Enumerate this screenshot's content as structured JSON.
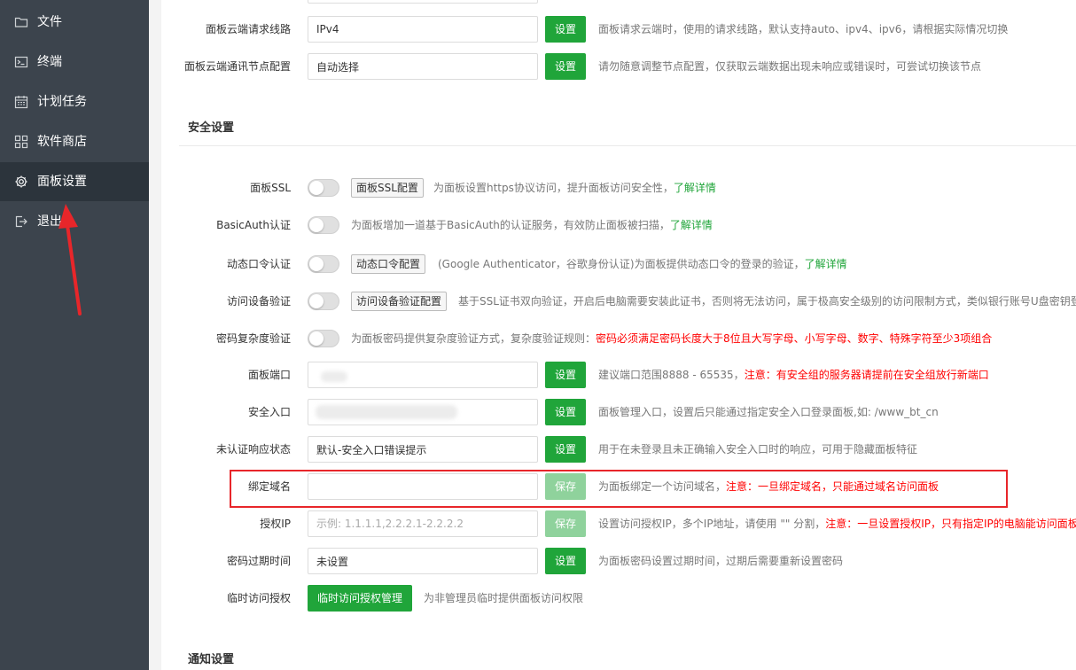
{
  "sidebar": {
    "items": [
      {
        "label": "文件",
        "icon": "folder-icon"
      },
      {
        "label": "终端",
        "icon": "terminal-icon"
      },
      {
        "label": "计划任务",
        "icon": "calendar-icon"
      },
      {
        "label": "软件商店",
        "icon": "grid-icon"
      },
      {
        "label": "面板设置",
        "icon": "gear-icon",
        "active": true
      },
      {
        "label": "退出",
        "icon": "logout-icon"
      }
    ]
  },
  "cloud": {
    "route": {
      "label": "面板云端请求线路",
      "value": "IPv4",
      "button": "设置",
      "desc": "面板请求云端时，使用的请求线路，默认支持auto、ipv4、ipv6，请根据实际情况切换"
    },
    "node": {
      "label": "面板云端通讯节点配置",
      "value": "自动选择",
      "button": "设置",
      "desc": "请勿随意调整节点配置，仅获取云端数据出现未响应或错误时，可尝试切换该节点"
    }
  },
  "security": {
    "title": "安全设置",
    "ssl": {
      "label": "面板SSL",
      "config": "面板SSL配置",
      "desc": "为面板设置https协议访问，提升面板访问安全性，",
      "link": "了解详情"
    },
    "basicauth": {
      "label": "BasicAuth认证",
      "desc": "为面板增加一道基于BasicAuth的认证服务，有效防止面板被扫描，",
      "link": "了解详情"
    },
    "otp": {
      "label": "动态口令认证",
      "config": "动态口令配置",
      "desc": "(Google Authenticator，谷歌身份认证)为面板提供动态口令的登录的验证，",
      "link": "了解详情"
    },
    "device": {
      "label": "访问设备验证",
      "config": "访问设备验证配置",
      "desc": "基于SSL证书双向验证，开启后电脑需要安装此证书，否则将无法访问，属于极高安全级别的访问限制方式，类似银行账号U盘密钥登"
    },
    "complexity": {
      "label": "密码复杂度验证",
      "desc": "为面板密码提供复杂度验证方式，复杂度验证规则：",
      "warn": "密码必须满足密码长度大于8位且大写字母、小写字母、数字、特殊字符至少3项组合"
    },
    "port": {
      "label": "面板端口",
      "button": "设置",
      "desc": "建议端口范围8888 - 65535，",
      "warn": "注意：有安全组的服务器请提前在安全组放行新端口"
    },
    "entry": {
      "label": "安全入口",
      "button": "设置",
      "desc": "面板管理入口，设置后只能通过指定安全入口登录面板,如: /www_bt_cn"
    },
    "unauth": {
      "label": "未认证响应状态",
      "value": "默认-安全入口错误提示",
      "button": "设置",
      "desc": "用于在未登录且未正确输入安全入口时的响应，可用于隐藏面板特征"
    },
    "domain": {
      "label": "绑定域名",
      "value": "",
      "button": "保存",
      "desc": "为面板绑定一个访问域名，",
      "warn": "注意：一旦绑定域名，只能通过域名访问面板"
    },
    "ip": {
      "label": "授权IP",
      "placeholder": "示例: 1.1.1.1,2.2.2.1-2.2.2.2",
      "button": "保存",
      "desc": "设置访问授权IP，多个IP地址，请使用 \"\" 分割，",
      "warn": "注意：一旦设置授权IP，只有指定IP的电脑能访问面板"
    },
    "expire": {
      "label": "密码过期时间",
      "value": "未设置",
      "button": "设置",
      "desc": "为面板密码设置过期时间，过期后需要重新设置密码"
    },
    "temp": {
      "label": "临时访问授权",
      "button": "临时访问授权管理",
      "desc": "为非管理员临时提供面板访问权限"
    }
  },
  "notify": {
    "title": "通知设置"
  },
  "colors": {
    "accent": "#20a53a",
    "sidebar_bg": "#3c444d",
    "sidebar_active": "#2c343c",
    "warn": "#ff0000",
    "highlight": "#e8262a"
  }
}
